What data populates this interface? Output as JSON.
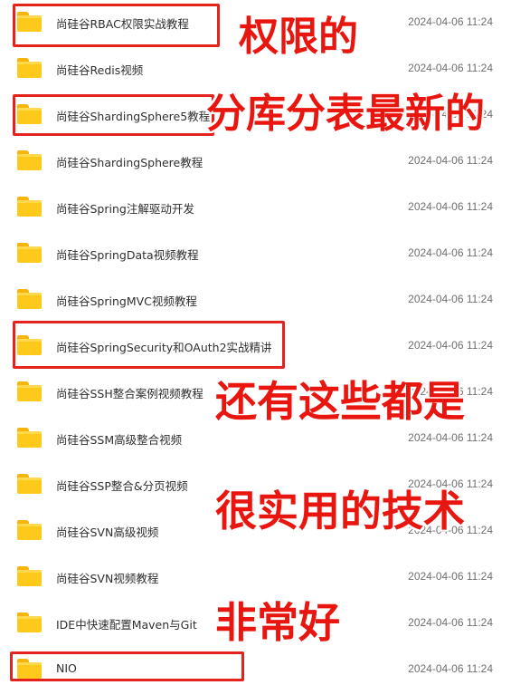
{
  "files": [
    {
      "name": "尚硅谷RBAC权限实战教程",
      "date": "2024-04-06 11:24"
    },
    {
      "name": "尚硅谷Redis视频",
      "date": "2024-04-06 11:24"
    },
    {
      "name": "尚硅谷ShardingSphere5教程",
      "date": "2024-04-06 11:24"
    },
    {
      "name": "尚硅谷ShardingSphere教程",
      "date": "2024-04-06 11:24"
    },
    {
      "name": "尚硅谷Spring注解驱动开发",
      "date": "2024-04-06 11:24"
    },
    {
      "name": "尚硅谷SpringData视频教程",
      "date": "2024-04-06 11:24"
    },
    {
      "name": "尚硅谷SpringMVC视频教程",
      "date": "2024-04-06 11:24"
    },
    {
      "name": "尚硅谷SpringSecurity和OAuth2实战精讲",
      "date": "2024-04-06 11:24"
    },
    {
      "name": "尚硅谷SSH整合案例视频教程",
      "date": "2024-04-06 11:24"
    },
    {
      "name": "尚硅谷SSM高级整合视频",
      "date": "2024-04-06 11:24"
    },
    {
      "name": "尚硅谷SSP整合&分页视频",
      "date": "2024-04-06 11:24"
    },
    {
      "name": "尚硅谷SVN高级视频",
      "date": "2024-04-06 11:24"
    },
    {
      "name": "尚硅谷SVN视频教程",
      "date": "2024-04-06 11:24"
    },
    {
      "name": "IDE中快速配置Maven与Git",
      "date": "2024-04-06 11:24"
    },
    {
      "name": "NIO",
      "date": "2024-04-06 11:24"
    }
  ],
  "annotations": {
    "permissions": "权限的",
    "sharding": "分库分表最新的",
    "also_these": "还有这些都是",
    "practical": "很实用的技术",
    "very_good": "非常好"
  },
  "colors": {
    "annotation_red": "#e8160f",
    "folder_yellow": "#ffc91c"
  },
  "icons": {
    "folder": "folder-icon"
  }
}
